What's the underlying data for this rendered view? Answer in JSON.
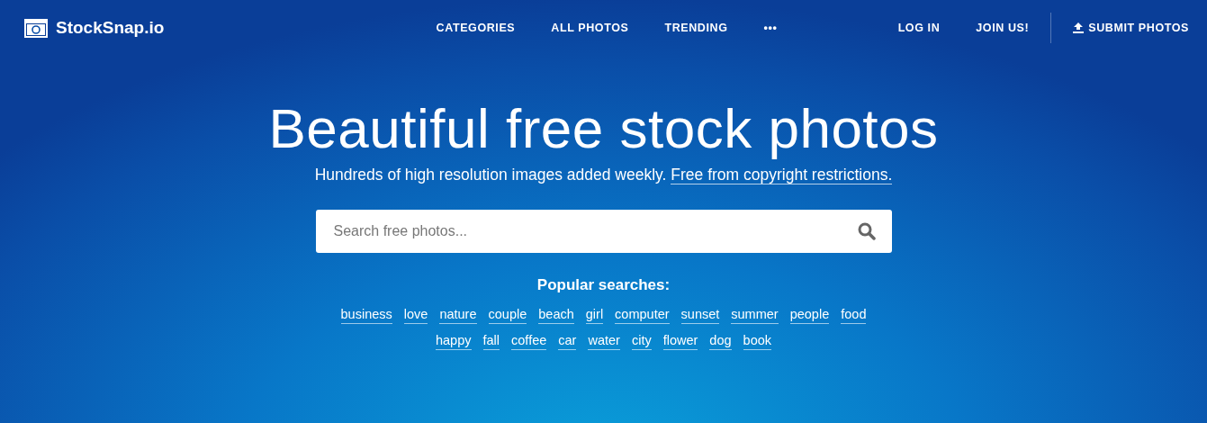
{
  "logo": {
    "text": "StockSnap.io"
  },
  "nav": [
    "CATEGORIES",
    "ALL PHOTOS",
    "TRENDING",
    "•••"
  ],
  "account": [
    "LOG IN",
    "JOIN US!"
  ],
  "submit": {
    "label": "SUBMIT PHOTOS"
  },
  "hero": {
    "title": "Beautiful free stock photos",
    "subtitle": "Hundreds of high resolution images added weekly.",
    "subtitle_link": "Free from copyright restrictions."
  },
  "search": {
    "placeholder": "Search free photos..."
  },
  "popular": {
    "title": "Popular searches:",
    "tags": [
      "business",
      "love",
      "nature",
      "couple",
      "beach",
      "girl",
      "computer",
      "sunset",
      "summer",
      "people",
      "food",
      "happy",
      "fall",
      "coffee",
      "car",
      "water",
      "city",
      "flower",
      "dog",
      "book"
    ]
  }
}
